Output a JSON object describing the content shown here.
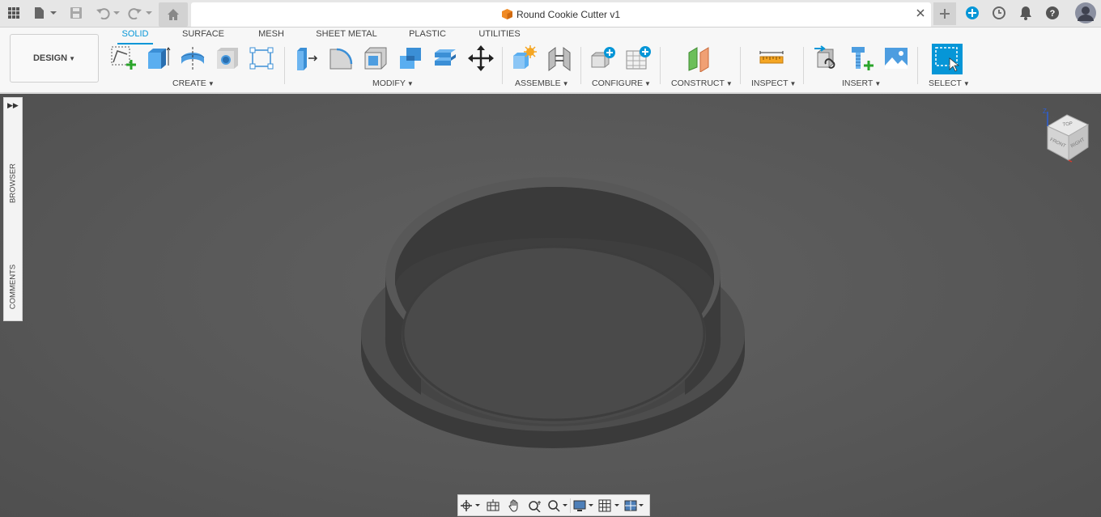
{
  "app": {
    "document_title": "Round Cookie Cutter v1",
    "workspace": "DESIGN"
  },
  "tabs": [
    {
      "label": "SOLID",
      "active": true
    },
    {
      "label": "SURFACE",
      "active": false
    },
    {
      "label": "MESH",
      "active": false
    },
    {
      "label": "SHEET METAL",
      "active": false
    },
    {
      "label": "PLASTIC",
      "active": false
    },
    {
      "label": "UTILITIES",
      "active": false
    }
  ],
  "groups": {
    "create": "CREATE",
    "modify": "MODIFY",
    "assemble": "ASSEMBLE",
    "configure": "CONFIGURE",
    "construct": "CONSTRUCT",
    "inspect": "INSPECT",
    "insert": "INSERT",
    "select": "SELECT"
  },
  "side_panel": {
    "browser": "BROWSER",
    "comments": "COMMENTS"
  },
  "viewcube": {
    "top": "TOP",
    "front": "FRONT",
    "right": "RIGHT",
    "axis_z": "Z"
  },
  "colors": {
    "accent": "#0696d7",
    "viewport": "#5a5a5a",
    "model": "#474747"
  },
  "icons": [
    "grid-icon",
    "file-icon",
    "save-icon",
    "undo-icon",
    "redo-icon",
    "home-icon",
    "new-tab-icon",
    "extensions-icon",
    "job-status-icon",
    "notifications-icon",
    "help-icon",
    "user-avatar-icon"
  ]
}
